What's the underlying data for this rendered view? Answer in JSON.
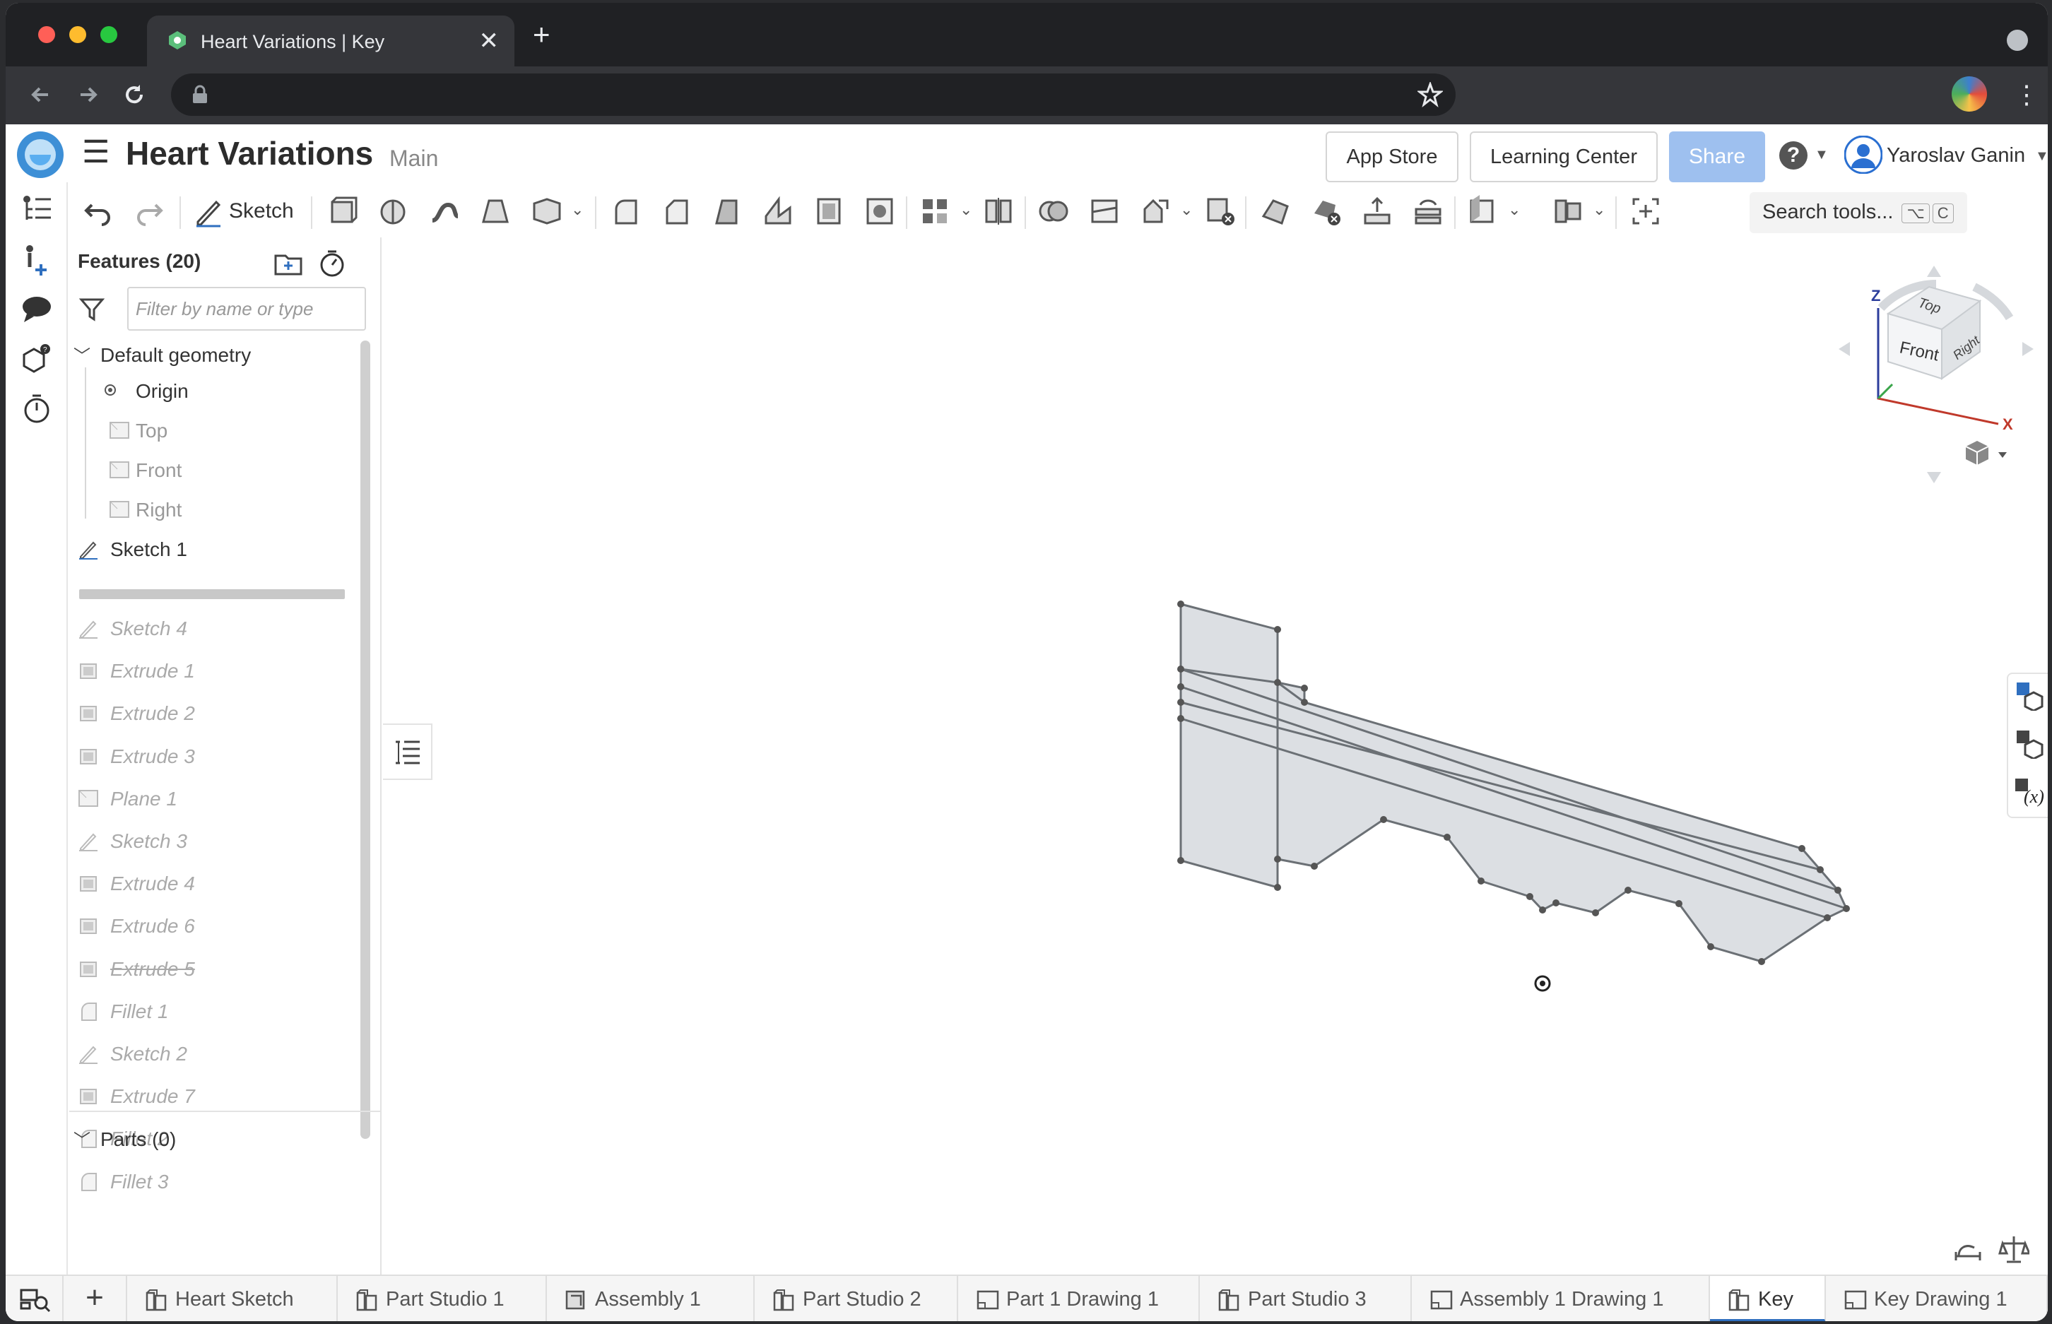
{
  "browser": {
    "tab_title": "Heart Variations | Key",
    "close_glyph": "✕",
    "new_tab_glyph": "+"
  },
  "header": {
    "menu_glyph": "☰",
    "doc_title": "Heart Variations",
    "branch": "Main",
    "app_store": "App Store",
    "learning_center": "Learning Center",
    "share": "Share",
    "help_glyph": "?",
    "user_name": "Yaroslav Ganin"
  },
  "toolbar": {
    "sketch_label": "Sketch",
    "search_tools": "Search tools...",
    "search_shortcut_1": "⌥",
    "search_shortcut_2": "C"
  },
  "features": {
    "title": "Features (20)",
    "filter_placeholder": "Filter by name or type",
    "default_geometry": "Default geometry",
    "origin": "Origin",
    "planes": [
      "Top",
      "Front",
      "Right"
    ],
    "sketch1": "Sketch 1",
    "suppressed": [
      "Sketch 4",
      "Extrude 1",
      "Extrude 2",
      "Extrude 3",
      "Plane 1",
      "Sketch 3",
      "Extrude 4",
      "Extrude 6",
      "Extrude 5",
      "Fillet 1",
      "Sketch 2",
      "Extrude 7",
      "Fillet 2",
      "Fillet 3"
    ],
    "parts": "Parts (0)"
  },
  "viewcube": {
    "top": "Top",
    "front": "Front",
    "right": "Right",
    "z": "Z",
    "x": "X"
  },
  "bottom_tabs": [
    "Heart Sketch",
    "Part Studio 1",
    "Assembly 1",
    "Part Studio 2",
    "Part 1 Drawing 1",
    "Part Studio 3",
    "Assembly 1 Drawing 1",
    "Key",
    "Key Drawing 1"
  ],
  "colors": {
    "accent": "#2f6fbf",
    "share_bg": "#9ec0ef",
    "sketch_fill": "#dcdfe3"
  }
}
